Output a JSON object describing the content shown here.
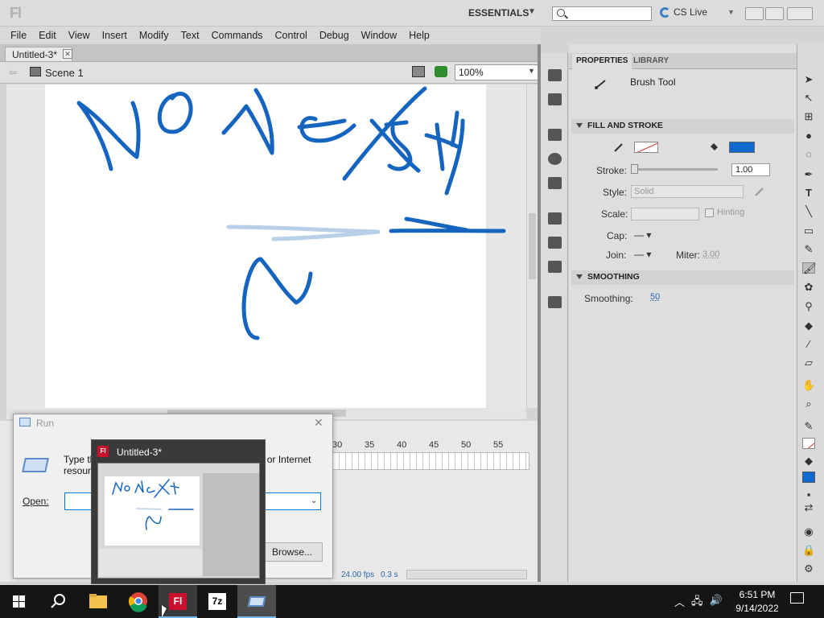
{
  "app": {
    "logo": "Fl",
    "workspace": "ESSENTIALS",
    "cs_live": "CS Live"
  },
  "menu": [
    "File",
    "Edit",
    "View",
    "Insert",
    "Modify",
    "Text",
    "Commands",
    "Control",
    "Debug",
    "Window",
    "Help"
  ],
  "document": {
    "tab_label": "Untitled-3*",
    "scene_label": "Scene 1",
    "zoom": "100%"
  },
  "timeline": {
    "ruler": [
      "30",
      "35",
      "40",
      "45",
      "50",
      "55"
    ],
    "fps": "24.00 fps",
    "time": "0.3 s"
  },
  "properties": {
    "tabs": [
      "PROPERTIES",
      "LIBRARY"
    ],
    "tool_name": "Brush Tool",
    "fill_stroke_title": "FILL AND STROKE",
    "stroke_label": "Stroke:",
    "stroke_value": "1.00",
    "style_label": "Style:",
    "style_value": "Solid",
    "scale_label": "Scale:",
    "hinting_label": "Hinting",
    "cap_label": "Cap:",
    "join_label": "Join:",
    "miter_label": "Miter:",
    "miter_value": "3.00",
    "smoothing_title": "SMOOTHING",
    "smoothing_label": "Smoothing:",
    "smoothing_value": "50",
    "fill_color": "#0f6bd1"
  },
  "run_dialog": {
    "title": "Run",
    "description": "Type the name of a program, folder, document, or Internet resource",
    "open_label": "Open:",
    "input_value": "",
    "browse_label": "Browse..."
  },
  "preview": {
    "title": "Untitled-3*"
  },
  "taskbar": {
    "time": "6:51 PM",
    "date": "9/14/2022",
    "flash_label": "Fl",
    "zip_label": "7z"
  },
  "colors": {
    "brush": "#1565c0",
    "accent": "#0078d7"
  }
}
